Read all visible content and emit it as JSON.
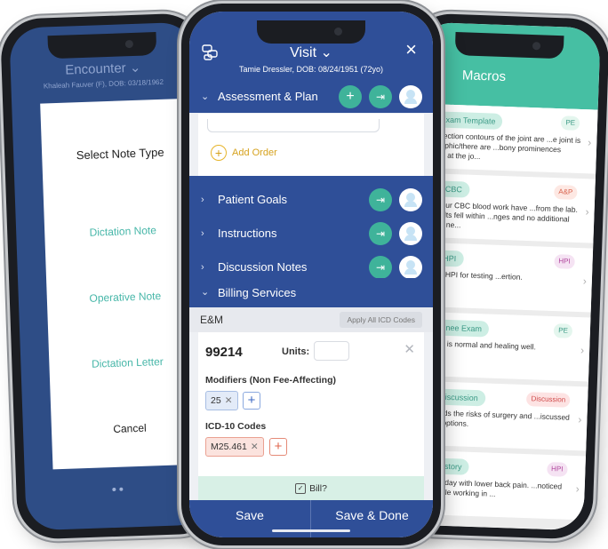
{
  "left_phone": {
    "header_title": "Encounter",
    "header_chevron": "⌄",
    "header_patient": "Khaleah Fauver (F), DOB: 03/18/1962",
    "dialog_title": "Select Note Type",
    "options": [
      "Dictation Note",
      "Operative Note",
      "Dictation Letter"
    ],
    "cancel": "Cancel"
  },
  "center_phone": {
    "header_title": "Visit",
    "header_chevron": "⌄",
    "patient": "Tamie Dressler, DOB: 08/24/1951 (72yo)",
    "close_icon": "×",
    "sections": {
      "assessment": "Assessment & Plan",
      "goals": "Patient Goals",
      "instructions": "Instructions",
      "discussion": "Discussion Notes",
      "billing": "Billing Services"
    },
    "chevron_right": "›",
    "chevron_down": "⌄",
    "add_order": "Add Order",
    "em_label": "E&M",
    "apply_icd": "Apply All ICD Codes",
    "code": "99214",
    "units_label": "Units:",
    "modifiers_label": "Modifiers (Non Fee-Affecting)",
    "modifier_chip": "25",
    "icd_label": "ICD-10 Codes",
    "icd_chip": "M25.461",
    "bill_label": "Bill?",
    "save": "Save",
    "save_done": "Save & Done"
  },
  "right_phone": {
    "header_title": "Macros",
    "macros": [
      {
        "name": "Knee Exam Template",
        "tag": "PE",
        "desc": "On inspection contours of the joint are ...e joint is hypertrophic/there are ...bony prominences palpable at the jo..."
      },
      {
        "name": "Normal CBC",
        "tag": "A&P",
        "desc": "...ts of your CBC blood work have ...from the lab. The results fell within ...nges and no additional testing is ne..."
      },
      {
        "name": "Normal HPI",
        "tag": "HPI",
        "desc": "...sample HPI for testing ...ertion."
      },
      {
        "name": "Normal Knee Exam",
        "tag": "PE",
        "desc": "...nts knee is normal and healing well."
      },
      {
        "name": "Sample Discussion",
        "tag": "Discussion",
        "desc": "...nderstands the risks of surgery and ...iscussed all of their options."
      },
      {
        "name": "Sample History",
        "tag": "HPI",
        "desc": "...resents today with lower back pain. ...noticed the pain while working in ..."
      }
    ]
  },
  "colors": {
    "brand_blue": "#2f4f98",
    "teal": "#3fb39a",
    "macro_teal": "#46bfa3"
  }
}
